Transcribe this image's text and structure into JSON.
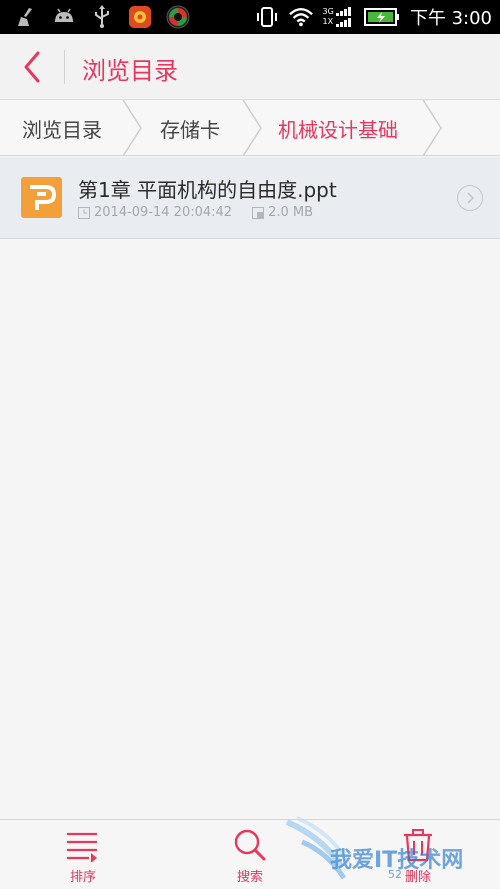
{
  "status_bar": {
    "time": "下午 3:00",
    "signal_top": "3G",
    "signal_bottom": "1X",
    "icons_left": [
      "broom-icon",
      "android-icon",
      "usb-icon",
      "app-icon-red",
      "app-icon-green-red"
    ],
    "icons_right": [
      "vibrate-icon",
      "wifi-icon",
      "signal-icon",
      "battery-charging-icon"
    ]
  },
  "header": {
    "title": "浏览目录",
    "accent_color": "#e8365d"
  },
  "breadcrumb": {
    "items": [
      {
        "label": "浏览目录",
        "active": false
      },
      {
        "label": "存储卡",
        "active": false
      },
      {
        "label": "机械设计基础",
        "active": true
      }
    ]
  },
  "files": [
    {
      "name": "第1章  平面机构的自由度.ppt",
      "date": "2014-09-14 20:04:42",
      "size": "2.0 MB",
      "icon": "ppt-file-icon",
      "icon_color": "#f3a03a"
    }
  ],
  "toolbar": {
    "sort_label": "排序",
    "search_label": "搜索",
    "delete_label": "删除"
  },
  "watermark": {
    "text": "我爱IT技术网",
    "sub": "52"
  }
}
